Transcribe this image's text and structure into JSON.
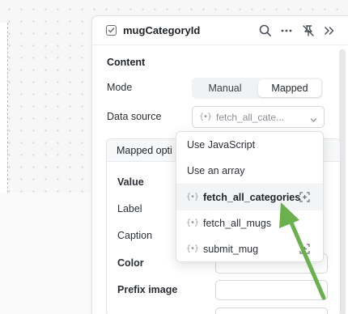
{
  "panel": {
    "title": "mugCategoryId"
  },
  "content": {
    "section_title": "Content",
    "mode_label": "Mode",
    "mode_options": [
      "Manual",
      "Mapped"
    ],
    "mode_selected": "Mapped",
    "data_source_label": "Data source",
    "data_source_value": "fetch_all_cate..."
  },
  "mapped_options": {
    "title": "Mapped opti",
    "rows": [
      "Value",
      "Label",
      "Caption",
      "Color",
      "Prefix image"
    ]
  },
  "dropdown": {
    "items": [
      {
        "label": "Use JavaScript",
        "type": "action"
      },
      {
        "label": "Use an array",
        "type": "action"
      },
      {
        "label": "fetch_all_categories",
        "type": "query",
        "selected": true
      },
      {
        "label": "fetch_all_mugs",
        "type": "query"
      },
      {
        "label": "submit_mug",
        "type": "query"
      }
    ],
    "query_icon_glyph": "{∙}"
  },
  "colors": {
    "accent_arrow": "#6ab04c",
    "panel_bg": "#ffffff",
    "selected_item_bg": "#f3f4f6"
  }
}
